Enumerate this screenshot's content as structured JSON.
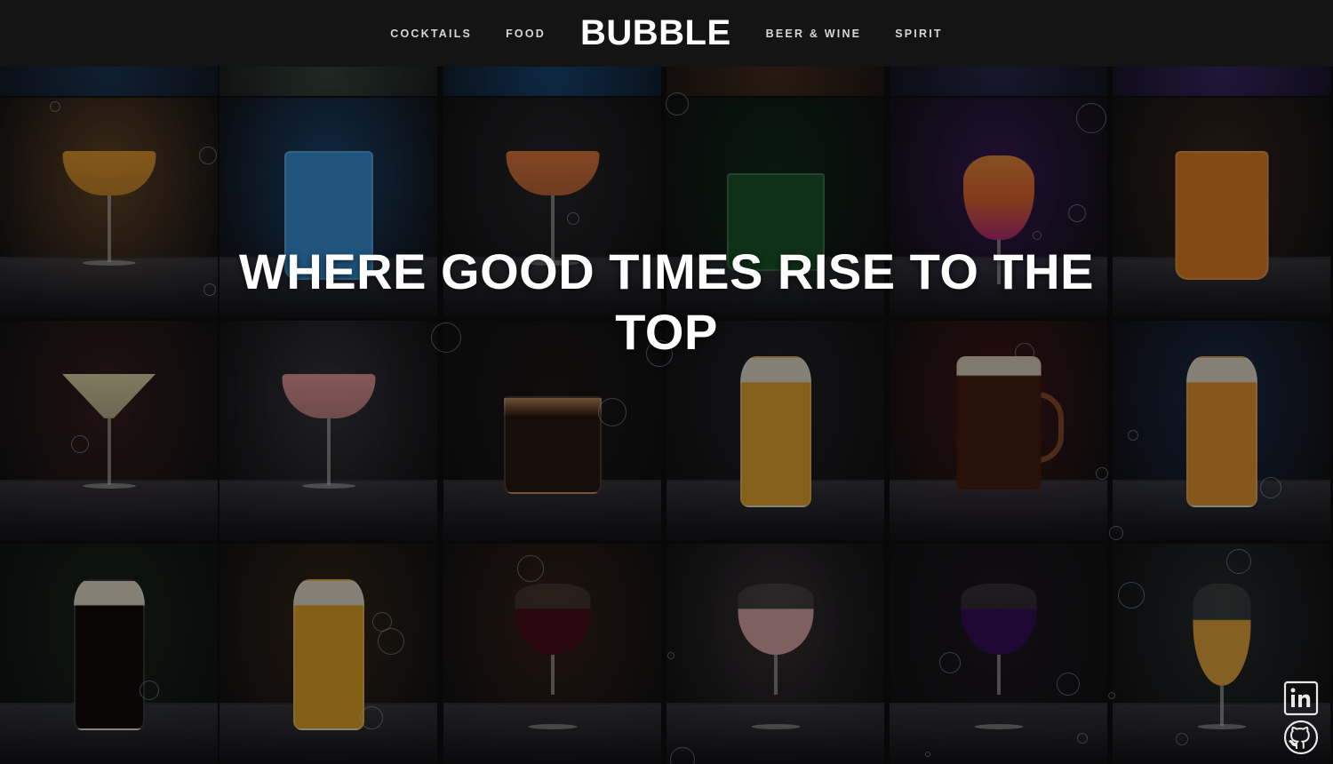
{
  "nav": {
    "left": [
      "COCKTAILS",
      "FOOD"
    ],
    "brand": "BUBBLE",
    "right": [
      "BEER & WINE",
      "SPIRIT"
    ]
  },
  "hero": {
    "title": "WHERE GOOD TIMES RISE TO THE TOP"
  },
  "social": {
    "linkedin": "linkedin-icon",
    "github": "github-icon"
  },
  "gallery": [
    {
      "name": "margarita",
      "bg": "#6b4a2a",
      "drink": "#f0a030",
      "type": "coupe"
    },
    {
      "name": "blue-highball",
      "bg": "#1d4b78",
      "drink": "#3a9be8",
      "type": "highball"
    },
    {
      "name": "orchid-coupe",
      "bg": "#2a2a2e",
      "drink": "#f08040",
      "type": "coupe"
    },
    {
      "name": "green-shot",
      "bg": "#0f2e1a",
      "drink": "#1d5a2a",
      "type": "rocks"
    },
    {
      "name": "neon-hurricane",
      "bg": "#3a1d5a",
      "drink": "#f07030",
      "type": "hurricane"
    },
    {
      "name": "orange-tumbler",
      "bg": "#3a2a20",
      "drink": "#f08828",
      "type": "tumbler"
    },
    {
      "name": "martini",
      "bg": "#3a2020",
      "drink": "#e8e0b0",
      "type": "martini"
    },
    {
      "name": "pink-coupe",
      "bg": "#3a3a40",
      "drink": "#f0a0a0",
      "type": "coupe"
    },
    {
      "name": "espresso",
      "bg": "#1f1a18",
      "drink": "#2a1810",
      "type": "rocks"
    },
    {
      "name": "lager-station",
      "bg": "#26262c",
      "drink": "#f0b030",
      "type": "pint"
    },
    {
      "name": "dark-stein",
      "bg": "#4a1a1a",
      "drink": "#4a2010",
      "type": "stein"
    },
    {
      "name": "pilsner-blue",
      "bg": "#1d3050",
      "drink": "#f0a030",
      "type": "pint"
    },
    {
      "name": "stout",
      "bg": "#1a2a1d",
      "drink": "#120c0a",
      "type": "pint"
    },
    {
      "name": "wheat-beer",
      "bg": "#3a2a18",
      "drink": "#f0b028",
      "type": "pint"
    },
    {
      "name": "red-wine",
      "bg": "#3a2418",
      "drink": "#4a0e1a",
      "type": "wine"
    },
    {
      "name": "rose-wine",
      "bg": "#3a3438",
      "drink": "#e8b0b0",
      "type": "wine"
    },
    {
      "name": "purple-wine",
      "bg": "#201a20",
      "drink": "#3a1060",
      "type": "wine"
    },
    {
      "name": "tulip-beer",
      "bg": "#2a2e30",
      "drink": "#f0b040",
      "type": "tulip"
    }
  ],
  "topStrip": [
    {
      "bg": "#1d3a5a"
    },
    {
      "bg": "#3a4a40"
    },
    {
      "bg": "#1a4a7a"
    },
    {
      "bg": "#4a3020"
    },
    {
      "bg": "#2a2a50"
    },
    {
      "bg": "#3a2a6a"
    }
  ]
}
